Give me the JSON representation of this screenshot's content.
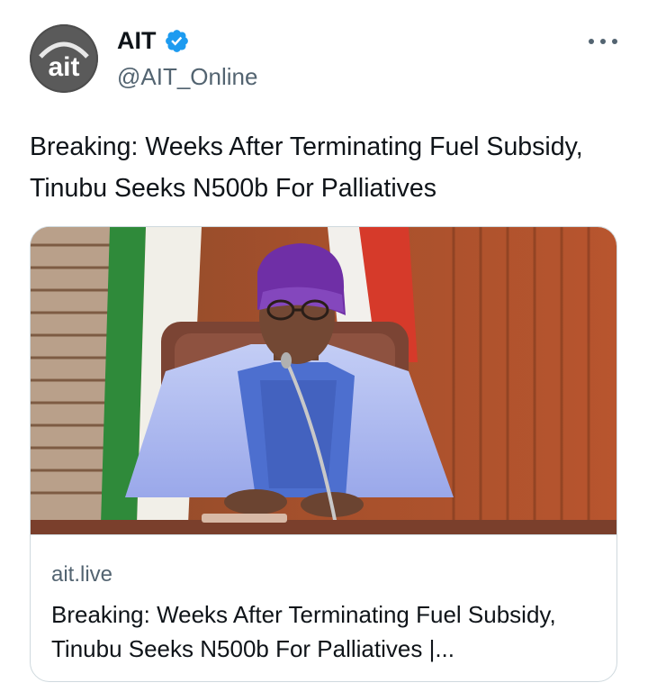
{
  "author": {
    "display_name": "AIT",
    "handle": "@AIT_Online",
    "avatar_text": "ait",
    "verified": true
  },
  "menu_icon": "more-horizontal-icon",
  "tweet": {
    "text": "Breaking: Weeks After Terminating Fuel Subsidy, Tinubu Seeks N500b For Palliatives"
  },
  "link_card": {
    "domain": "ait.live",
    "title": "Breaking: Weeks After Terminating Fuel Subsidy, Tinubu Seeks N500b For Palliatives |..."
  },
  "colors": {
    "verified_blue": "#1d9bf0",
    "secondary_text": "#536471",
    "card_border": "#cfd9de"
  }
}
